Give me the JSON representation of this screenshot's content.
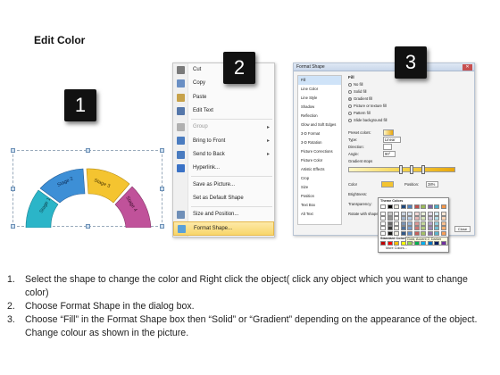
{
  "title": "Edit Color",
  "badges": [
    "1",
    "2",
    "3"
  ],
  "arc": {
    "stages": [
      "Stage 1",
      "Stage 2",
      "Stage 3",
      "Stage 4"
    ],
    "colors": [
      "#2bb5c8",
      "#3d8fd6",
      "#f4c430",
      "#c0529a"
    ]
  },
  "context_menu": {
    "items": [
      {
        "label": "Cut",
        "icon": "scissors-icon",
        "color": "#7a7a7a",
        "disabled": false,
        "submenu": false
      },
      {
        "label": "Copy",
        "icon": "copy-icon",
        "color": "#6a8fc4",
        "disabled": false,
        "submenu": false
      },
      {
        "label": "Paste",
        "icon": "paste-icon",
        "color": "#c7a24a",
        "disabled": false,
        "submenu": false
      },
      {
        "label": "Edit Text",
        "icon": "edit-text-icon",
        "color": "#5577aa",
        "disabled": false,
        "submenu": false
      },
      {
        "label": "Group",
        "icon": "group-icon",
        "color": "#b0b0b0",
        "disabled": true,
        "submenu": true
      },
      {
        "label": "Bring to Front",
        "icon": "bring-front-icon",
        "color": "#4a7cc0",
        "disabled": false,
        "submenu": true
      },
      {
        "label": "Send to Back",
        "icon": "send-back-icon",
        "color": "#4a7cc0",
        "disabled": false,
        "submenu": true
      },
      {
        "label": "Hyperlink...",
        "icon": "hyperlink-icon",
        "color": "#3a72c6",
        "disabled": false,
        "submenu": false
      },
      {
        "label": "Save as Picture...",
        "icon": "",
        "color": "",
        "disabled": false,
        "submenu": false
      },
      {
        "label": "Set as Default Shape",
        "icon": "",
        "color": "",
        "disabled": false,
        "submenu": false
      },
      {
        "label": "Size and Position...",
        "icon": "size-icon",
        "color": "#6f8fb8",
        "disabled": false,
        "submenu": false
      },
      {
        "label": "Format Shape...",
        "icon": "format-shape-icon",
        "color": "#5aa0d8",
        "disabled": false,
        "submenu": false,
        "selected": true
      }
    ]
  },
  "dialog": {
    "title": "Format Shape",
    "categories": [
      "Fill",
      "Line Color",
      "Line Style",
      "Shadow",
      "Reflection",
      "Glow and Soft Edges",
      "3-D Format",
      "3-D Rotation",
      "Picture Corrections",
      "Picture Color",
      "Artistic Effects",
      "Crop",
      "Size",
      "Position",
      "Text Box",
      "Alt Text"
    ],
    "section": "Fill",
    "options": [
      "No fill",
      "Solid fill",
      "Gradient fill",
      "Picture or texture fill",
      "Pattern fill",
      "Slide background fill"
    ],
    "selected_option": "Gradient fill",
    "preset_label": "Preset colors:",
    "type_label": "Type:",
    "type_value": "Linear",
    "direction_label": "Direction:",
    "angle_label": "Angle:",
    "angle_value": "90°",
    "stops_label": "Gradient stops",
    "color_label": "Color",
    "position_label": "Position:",
    "position_value": "38%",
    "brightness_label": "Brightness:",
    "transparency_label": "Transparency:",
    "rotate_label": "Rotate with shape",
    "theme_colors_label": "Theme Colors",
    "standard_colors_label": "Standard Colors",
    "tooltip": "Gold, Accent 2, Darker 25%",
    "more_colors": "More Colors...",
    "close_label": "Close"
  },
  "steps": [
    "Select the shape to change the color and Right click the object( click any object which you want to change color)",
    "Choose Format Shape in the dialog box.",
    "Choose “Fill” in the Format Shape box then “Solid” or “Gradient” depending on the appearance of the object. Change colour as shown in the picture."
  ],
  "step_numbers": [
    "1.",
    "2.",
    "3."
  ]
}
